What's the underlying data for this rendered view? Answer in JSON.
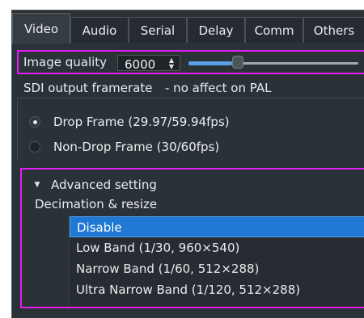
{
  "tabs": [
    {
      "label": "Video",
      "active": true
    },
    {
      "label": "Audio",
      "active": false
    },
    {
      "label": "Serial",
      "active": false
    },
    {
      "label": "Delay",
      "active": false
    },
    {
      "label": "Comm",
      "active": false
    },
    {
      "label": "Others",
      "active": false
    }
  ],
  "image_quality": {
    "label": "Image quality",
    "value": "6000",
    "slider_level_percent": 25
  },
  "sdi_output": {
    "title": "SDI output framerate",
    "note": "- no affect on PAL",
    "options": [
      {
        "label": "Drop Frame (29.97/59.94fps)",
        "checked": true
      },
      {
        "label": "Non-Drop Frame (30/60fps)",
        "checked": false
      }
    ]
  },
  "advanced": {
    "label": "Advanced setting",
    "expanded": true,
    "decimation_label": "Decimation & resize",
    "items": [
      {
        "label": "Disable",
        "selected": true
      },
      {
        "label": "Low Band (1/30, 960×540)",
        "selected": false
      },
      {
        "label": "Narrow Band (1/60, 512×288)",
        "selected": false
      },
      {
        "label": "Ultra Narrow Band (1/120, 512×288)",
        "selected": false
      }
    ]
  },
  "colors": {
    "background": "#2b3237",
    "highlight_border": "#e41cf5",
    "selection": "#1f79d4",
    "slider_accent": "#5aa0e6"
  },
  "icons": {
    "spin_up": "chevron-up-icon",
    "spin_down": "chevron-down-icon",
    "expander": "triangle-down-icon"
  }
}
